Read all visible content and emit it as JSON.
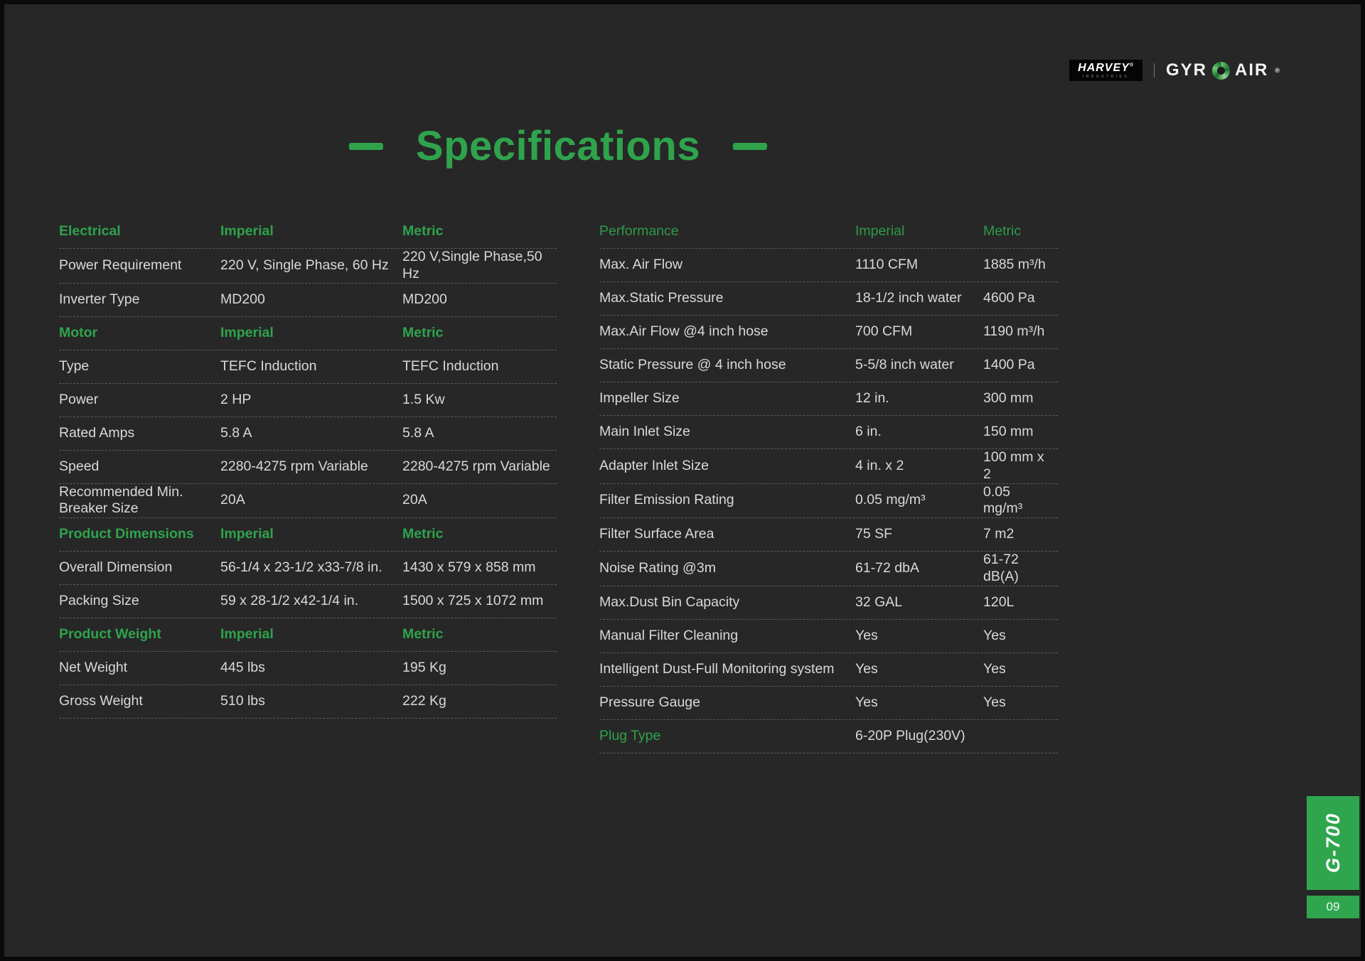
{
  "colors": {
    "accent_green": "#2fa34c",
    "tab_green": "#2fa64e"
  },
  "brand": {
    "harvey_name": "HARVEY",
    "harvey_reg": "®",
    "harvey_sub": "INDUSTRIES",
    "gyro_left": "GYR",
    "gyro_right": "AIR",
    "gyro_reg": "®"
  },
  "title": {
    "text": "Specifications"
  },
  "side_tab": {
    "model": "G-700",
    "page_number": "09"
  },
  "left_table": {
    "rows": [
      {
        "type": "header",
        "cells": [
          "Electrical",
          "Imperial",
          "Metric"
        ]
      },
      {
        "type": "data",
        "cells": [
          "Power Requirement",
          "220 V, Single Phase, 60 Hz",
          "220 V,Single Phase,50 Hz"
        ]
      },
      {
        "type": "data",
        "cells": [
          "Inverter Type",
          "MD200",
          "MD200"
        ]
      },
      {
        "type": "header",
        "cells": [
          "Motor",
          "Imperial",
          "Metric"
        ]
      },
      {
        "type": "data",
        "cells": [
          "Type",
          "TEFC Induction",
          "TEFC Induction"
        ]
      },
      {
        "type": "data",
        "cells": [
          "Power",
          "2 HP",
          "1.5 Kw"
        ]
      },
      {
        "type": "data",
        "cells": [
          "Rated Amps",
          "5.8 A",
          "5.8 A"
        ]
      },
      {
        "type": "data",
        "cells": [
          "Speed",
          "2280-4275 rpm Variable",
          "2280-4275 rpm Variable"
        ]
      },
      {
        "type": "data",
        "cells": [
          "Recommended Min. Breaker Size",
          "20A",
          "20A"
        ]
      },
      {
        "type": "header",
        "cells": [
          "Product  Dimensions",
          "Imperial",
          "Metric"
        ]
      },
      {
        "type": "data",
        "cells": [
          "Overall Dimension",
          "56-1/4 x 23-1/2 x33-7/8 in.",
          "1430 x 579 x 858 mm"
        ]
      },
      {
        "type": "data",
        "cells": [
          "Packing Size",
          "59 x 28-1/2 x42-1/4 in.",
          "1500 x 725 x 1072 mm"
        ]
      },
      {
        "type": "header",
        "cells": [
          "Product Weight",
          "Imperial",
          "Metric"
        ]
      },
      {
        "type": "data",
        "cells": [
          "Net Weight",
          "445 lbs",
          "195 Kg"
        ]
      },
      {
        "type": "data",
        "cells": [
          "Gross Weight",
          "510 lbs",
          "222 Kg"
        ]
      }
    ]
  },
  "right_table": {
    "rows": [
      {
        "type": "header",
        "cells": [
          "Performance",
          "Imperial",
          "Metric"
        ]
      },
      {
        "type": "data",
        "cells": [
          "Max. Air Flow",
          "1110 CFM",
          "1885 m³/h"
        ]
      },
      {
        "type": "data",
        "cells": [
          "Max.Static Pressure",
          "18-1/2 inch water",
          "4600 Pa"
        ]
      },
      {
        "type": "data",
        "cells": [
          "Max.Air Flow @4  inch hose",
          "700 CFM",
          "1190 m³/h"
        ]
      },
      {
        "type": "data",
        "cells": [
          "Static Pressure @ 4 inch hose",
          "5-5/8 inch water",
          "1400 Pa"
        ]
      },
      {
        "type": "data",
        "cells": [
          "Impeller Size",
          "12 in.",
          "300 mm"
        ]
      },
      {
        "type": "data",
        "cells": [
          "Main Inlet Size",
          "6 in.",
          "150 mm"
        ]
      },
      {
        "type": "data",
        "cells": [
          "Adapter Inlet Size",
          "4 in. x 2",
          "100 mm x 2"
        ]
      },
      {
        "type": "data",
        "cells": [
          "Filter Emission Rating",
          "0.05 mg/m³",
          "0.05 mg/m³"
        ]
      },
      {
        "type": "data",
        "cells": [
          "Filter Surface Area",
          "75 SF",
          "7 m2"
        ]
      },
      {
        "type": "data",
        "cells": [
          "Noise Rating @3m",
          "61-72 dbA",
          "61-72 dB(A)"
        ]
      },
      {
        "type": "data",
        "cells": [
          "Max.Dust Bin Capacity",
          "32 GAL",
          "120L"
        ]
      },
      {
        "type": "data",
        "cells": [
          "Manual Filter Cleaning",
          "Yes",
          "Yes"
        ]
      },
      {
        "type": "data",
        "cells": [
          "Intelligent Dust-Full Monitoring system",
          "Yes",
          "Yes"
        ]
      },
      {
        "type": "data",
        "cells": [
          "Pressure Gauge",
          "Yes",
          "Yes"
        ]
      },
      {
        "type": "data",
        "accent": true,
        "cells": [
          "Plug Type",
          "6-20P Plug(230V)",
          ""
        ]
      }
    ]
  }
}
